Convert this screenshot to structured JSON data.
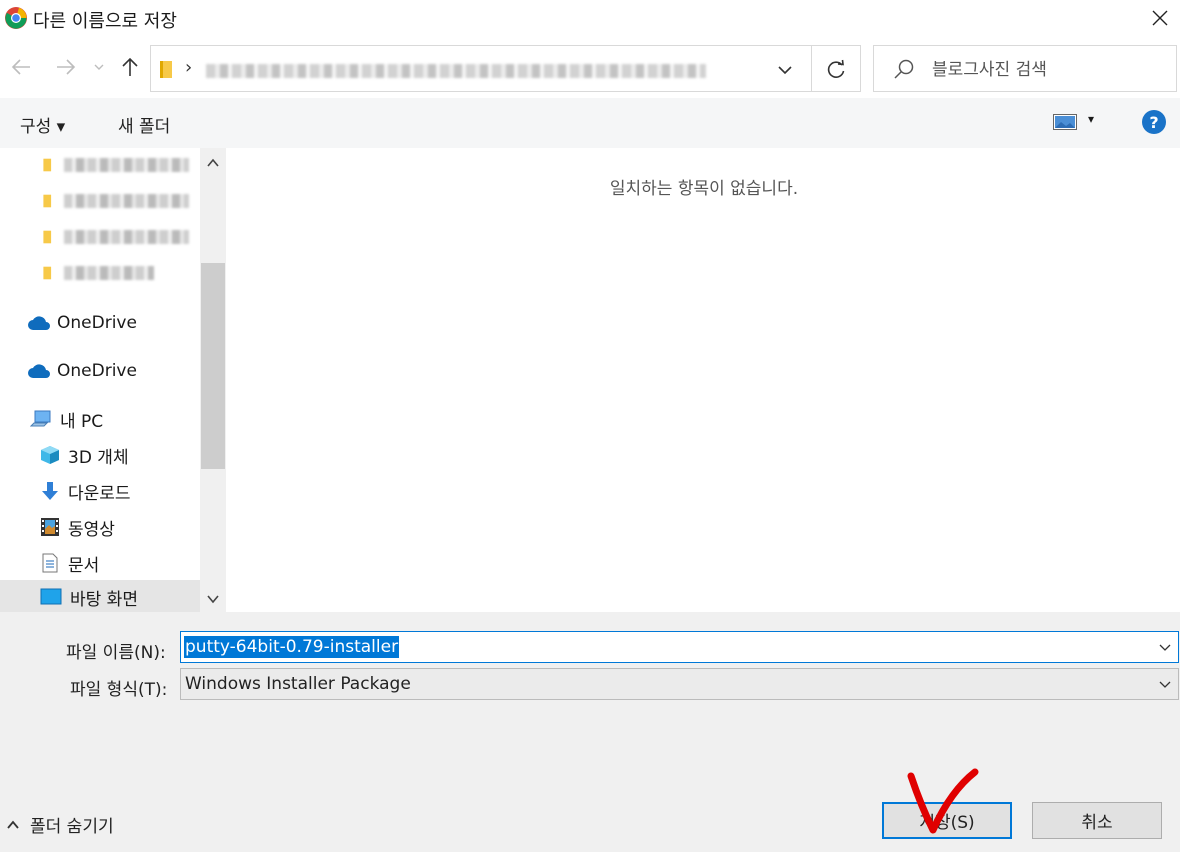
{
  "window": {
    "title": "다른 이름으로 저장",
    "app_icon": "chrome-icon",
    "close_icon": "close-icon"
  },
  "nav": {
    "back_icon": "arrow-left-icon",
    "forward_icon": "arrow-right-icon",
    "recent_icon": "chevron-down-icon",
    "up_icon": "arrow-up-icon",
    "address_separator": "›",
    "refresh_icon": "refresh-icon"
  },
  "search": {
    "placeholder": "블로그사진 검색"
  },
  "toolbar": {
    "organize_label": "구성 ▾",
    "new_folder_label": "새 폴더",
    "view_dropdown": "▾",
    "help_label": "?"
  },
  "sidebar": {
    "items": [
      {
        "label": "",
        "icon": "folder-icon",
        "blurred": true
      },
      {
        "label": "",
        "icon": "folder-icon",
        "blurred": true
      },
      {
        "label": "",
        "icon": "folder-icon",
        "blurred": true
      },
      {
        "label": "",
        "icon": "folder-icon",
        "blurred": true
      },
      {
        "label": "OneDrive",
        "icon": "onedrive-icon"
      },
      {
        "label": "OneDrive",
        "icon": "onedrive-icon"
      },
      {
        "label": "내 PC",
        "icon": "pc-icon"
      },
      {
        "label": "3D 개체",
        "icon": "3d-objects-icon"
      },
      {
        "label": "다운로드",
        "icon": "download-icon"
      },
      {
        "label": "동영상",
        "icon": "video-icon"
      },
      {
        "label": "문서",
        "icon": "document-icon"
      },
      {
        "label": "바탕 화면",
        "icon": "desktop-icon",
        "selected": true
      }
    ]
  },
  "content": {
    "empty_message": "일치하는 항목이 없습니다."
  },
  "form": {
    "filename_label": "파일 이름(N):",
    "filename_value": "putty-64bit-0.79-installer",
    "filetype_label": "파일 형식(T):",
    "filetype_value": "Windows Installer Package",
    "hide_folders_label": "폴더 숨기기",
    "save_label": "저장(S)",
    "cancel_label": "취소"
  },
  "colors": {
    "accent": "#0078d7",
    "annotation": "#e00000"
  }
}
